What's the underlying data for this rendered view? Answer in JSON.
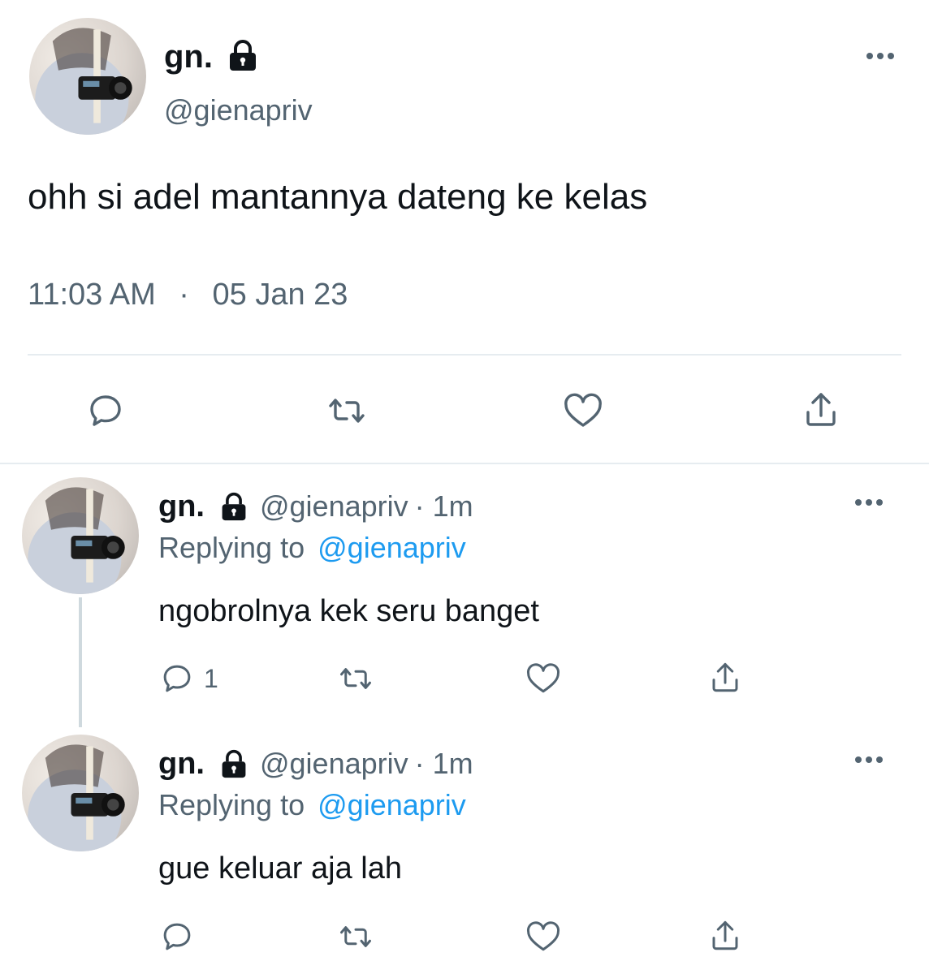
{
  "main_tweet": {
    "display_name": "gn.",
    "handle": "@gienapriv",
    "text": "ohh si adel mantannya dateng ke kelas",
    "time": "11:03 AM",
    "separator": "·",
    "date": "05 Jan 23"
  },
  "replies": [
    {
      "display_name": "gn.",
      "handle": "@gienapriv",
      "time_ago": "· 1m",
      "replying_label": "Replying to",
      "replying_handle": "@gienapriv",
      "text": "ngobrolnya kek seru banget",
      "reply_count": "1"
    },
    {
      "display_name": "gn.",
      "handle": "@gienapriv",
      "time_ago": "· 1m",
      "replying_label": "Replying to",
      "replying_handle": "@gienapriv",
      "text": "gue keluar aja lah",
      "reply_count": ""
    }
  ],
  "icons": [
    "lock-icon",
    "more-icon",
    "reply-icon",
    "retweet-icon",
    "like-icon",
    "share-icon"
  ],
  "colors": {
    "link": "#1d9bf0",
    "muted": "#536471",
    "text": "#0f1419",
    "thread_line": "#cfd9de"
  }
}
